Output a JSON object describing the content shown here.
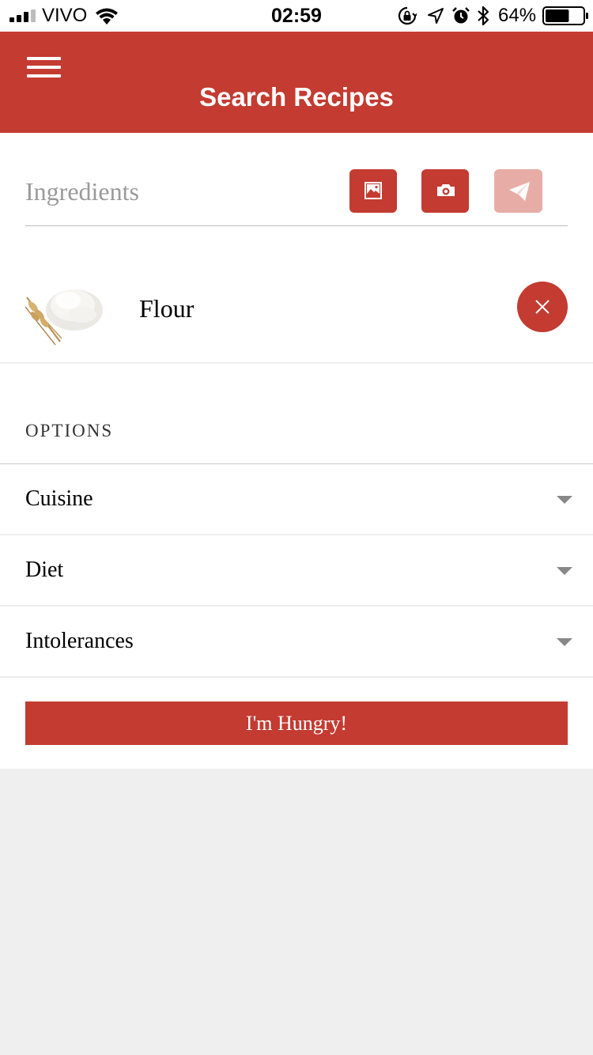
{
  "status_bar": {
    "carrier": "VIVO",
    "time": "02:59",
    "battery_percent": "64%",
    "battery_level": 0.64,
    "icons": [
      "signal-icon",
      "wifi-icon",
      "orientation-lock-icon",
      "location-icon",
      "alarm-icon",
      "bluetooth-icon",
      "battery-icon"
    ]
  },
  "header": {
    "title": "Search Recipes",
    "menu_icon": "hamburger-menu-icon"
  },
  "search": {
    "placeholder": "Ingredients",
    "value": "",
    "buttons": [
      {
        "name": "gallery",
        "icon": "image-icon"
      },
      {
        "name": "camera",
        "icon": "camera-icon"
      },
      {
        "name": "send",
        "icon": "paper-plane-icon",
        "disabled": true
      }
    ]
  },
  "ingredients": [
    {
      "name": "Flour",
      "image": "flour-image",
      "remove_icon": "close-icon"
    }
  ],
  "options": {
    "heading": "OPTIONS",
    "items": [
      {
        "label": "Cuisine",
        "icon": "chevron-down-icon"
      },
      {
        "label": "Diet",
        "icon": "chevron-down-icon"
      },
      {
        "label": "Intolerances",
        "icon": "chevron-down-icon"
      }
    ]
  },
  "submit_label": "I'm Hungry!",
  "colors": {
    "accent": "#c33b31",
    "accent_disabled": "#e8aca7",
    "background": "#efefef"
  }
}
